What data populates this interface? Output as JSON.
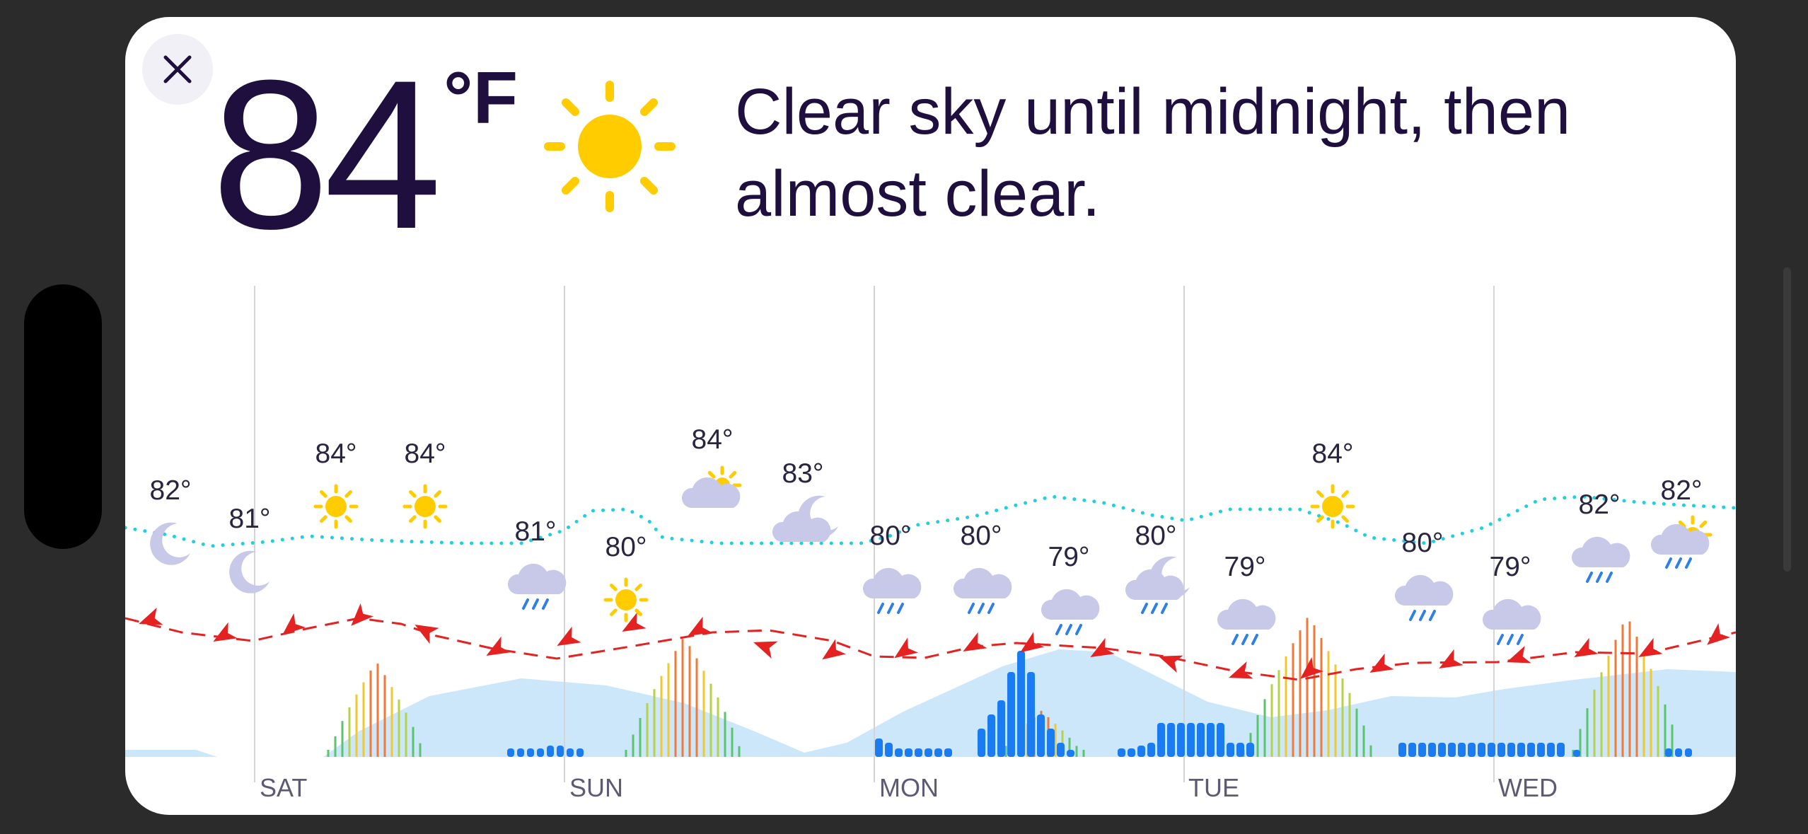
{
  "current": {
    "temperature": "84",
    "unit": "°F",
    "condition_icon": "sun-icon",
    "summary": "Clear sky until midnight, then almost clear."
  },
  "controls": {
    "close_icon": "close-icon"
  },
  "timeline": {
    "days": [
      "SAT",
      "SUN",
      "MON",
      "TUE",
      "WED"
    ],
    "temperatures": [
      {
        "label": "82°",
        "icon": "moon"
      },
      {
        "label": "81°",
        "icon": "moon"
      },
      {
        "label": "84°",
        "icon": "sun"
      },
      {
        "label": "84°",
        "icon": "sun"
      },
      {
        "label": "81°",
        "icon": "rain"
      },
      {
        "label": "80°",
        "icon": "sun"
      },
      {
        "label": "84°",
        "icon": "partly-sunny"
      },
      {
        "label": "83°",
        "icon": "partly-cloudy-night"
      },
      {
        "label": "80°",
        "icon": "rain"
      },
      {
        "label": "80°",
        "icon": "rain"
      },
      {
        "label": "79°",
        "icon": "rain"
      },
      {
        "label": "80°",
        "icon": "rain-night"
      },
      {
        "label": "79°",
        "icon": "rain"
      },
      {
        "label": "84°",
        "icon": "sun"
      },
      {
        "label": "80°",
        "icon": "rain"
      },
      {
        "label": "79°",
        "icon": "rain"
      },
      {
        "label": "82°",
        "icon": "rain"
      },
      {
        "label": "82°",
        "icon": "rain-sun"
      }
    ]
  },
  "colors": {
    "text": "#1e0f3e",
    "sun": "#ffcc00",
    "cloud": "#c8c8e8",
    "rain_drop": "#2e7fe6",
    "dew_line": "#1ed0e0",
    "wind": "#e52222",
    "cloud_cover": "#cce6fa",
    "precip_bar": "#1a7cf0"
  }
}
